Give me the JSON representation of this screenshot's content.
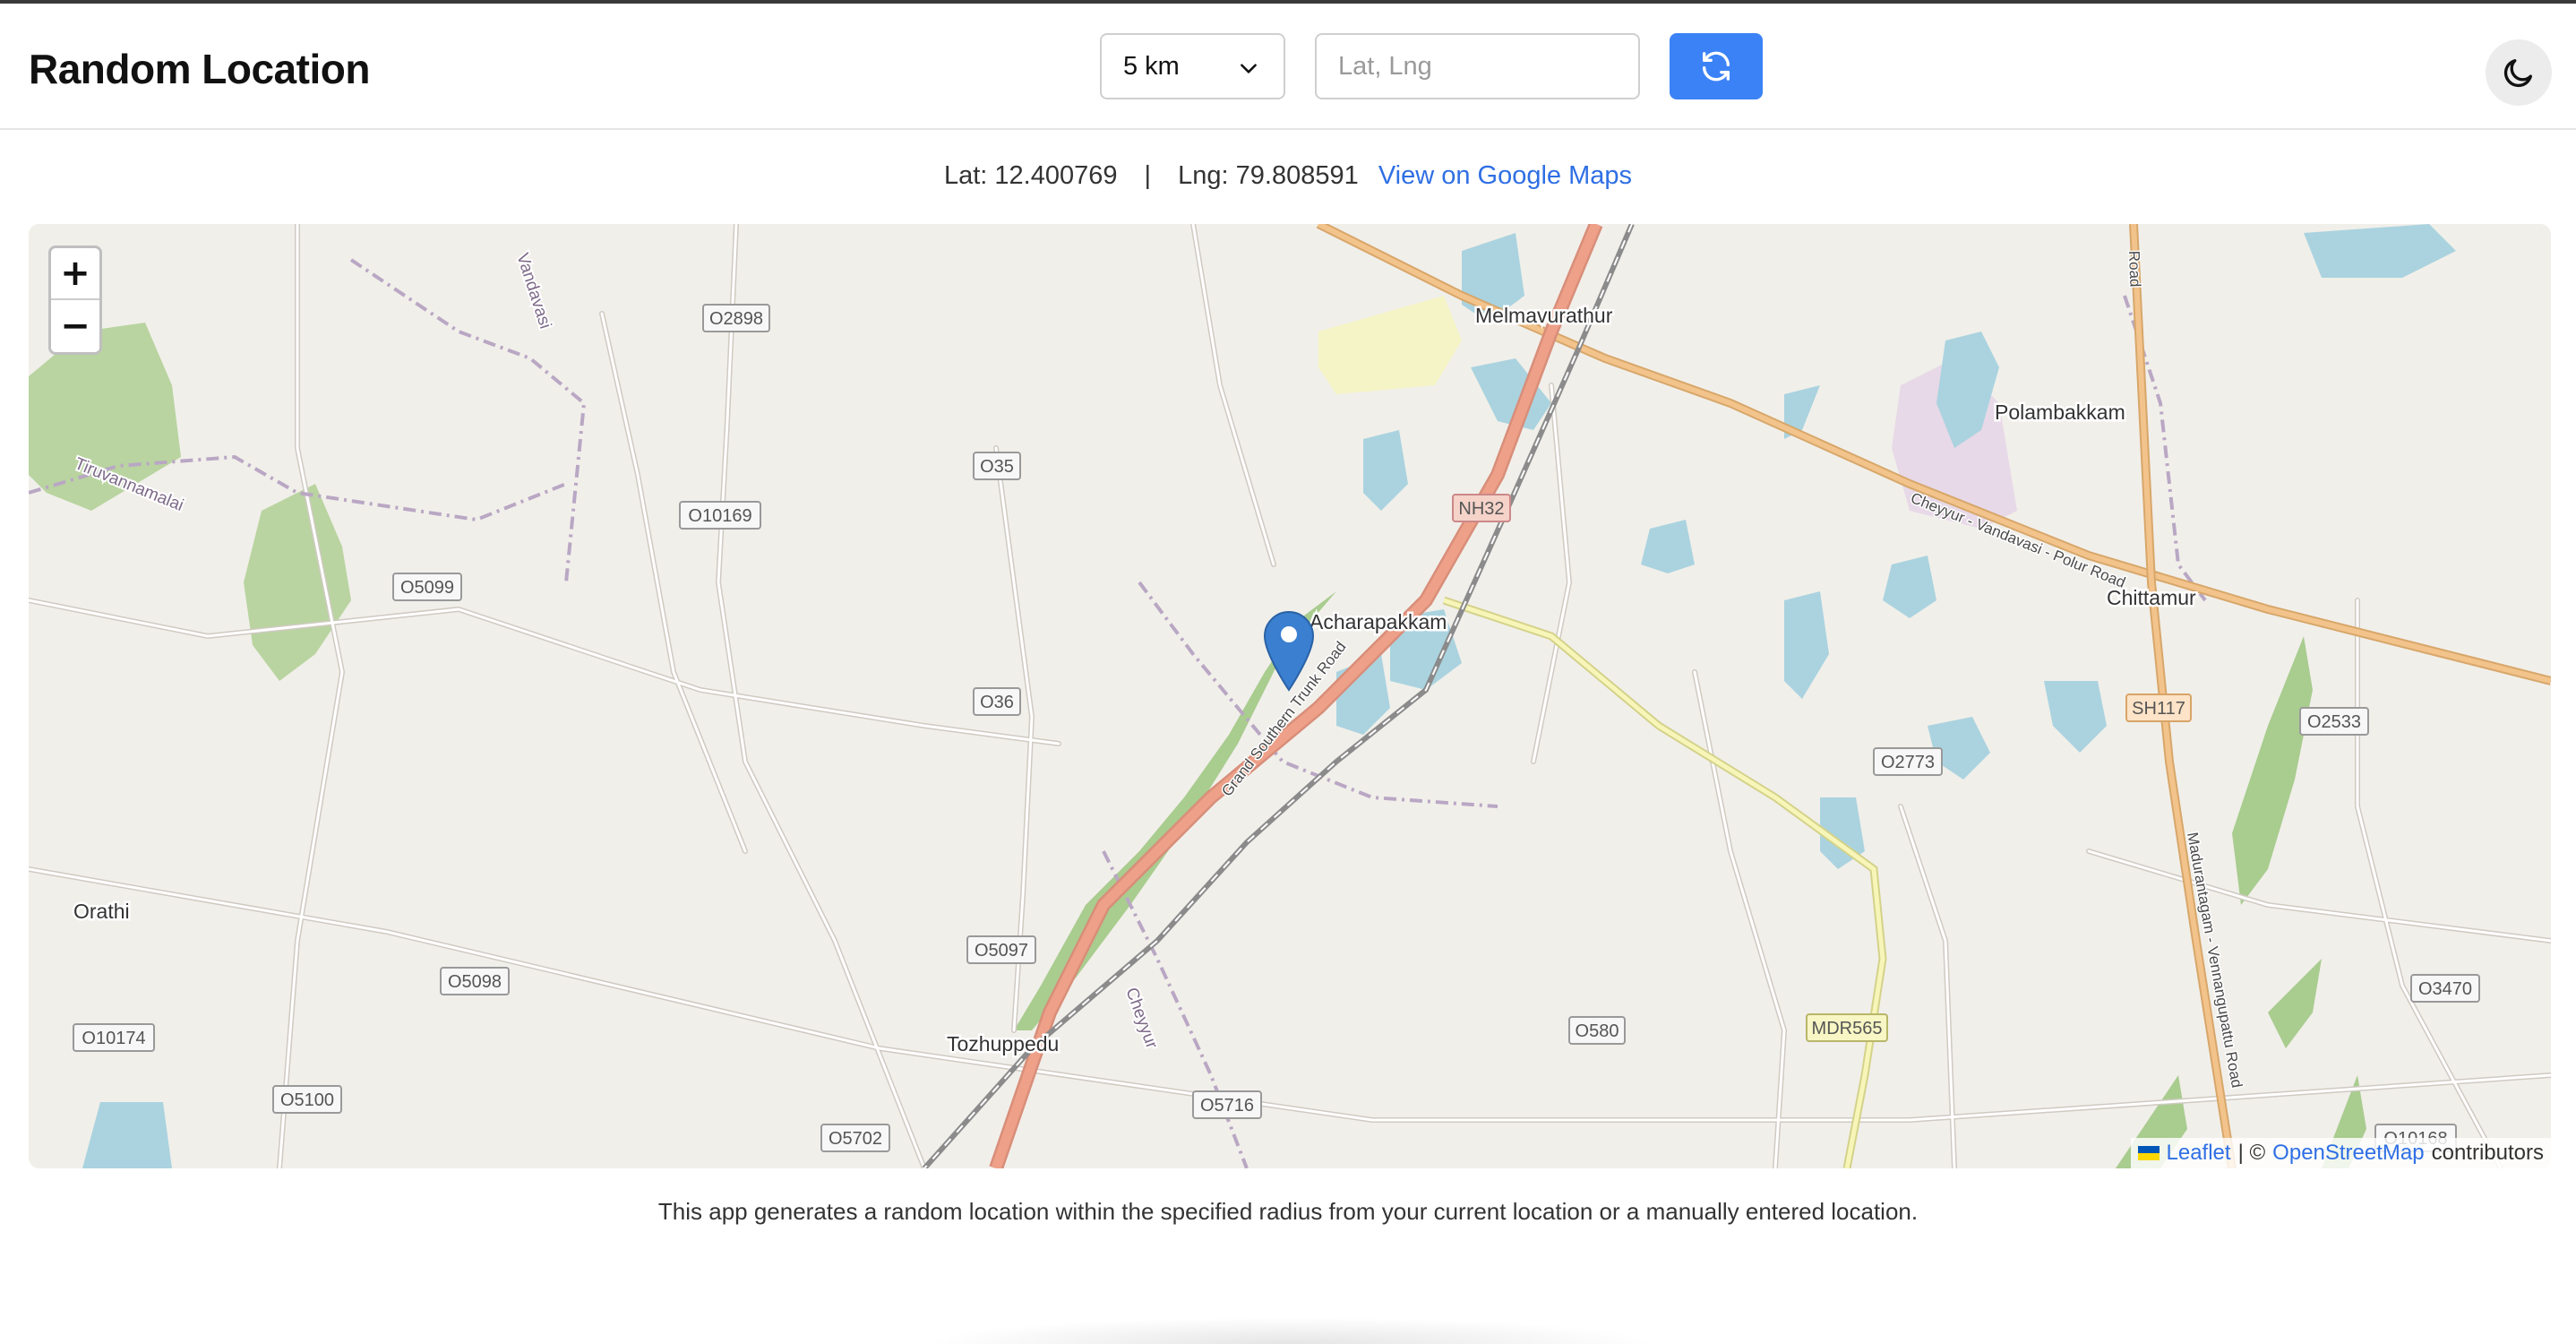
{
  "app": {
    "title": "Random Location"
  },
  "controls": {
    "radius": {
      "selected": "5 km"
    },
    "coordinates": {
      "placeholder": "Lat, Lng",
      "value": ""
    },
    "refresh_icon": "refresh-icon",
    "theme_icon": "moon-icon",
    "accent_color": "#3b82f6"
  },
  "result": {
    "lat": "Lat: 12.400769",
    "separator": "|",
    "lng": "Lng: 79.808591",
    "maps_link": "View on Google Maps"
  },
  "map": {
    "zoom_in": "+",
    "zoom_out": "−",
    "places": {
      "melmavurathur": "Melmavurathur",
      "polambakkam": "Polambakkam",
      "acharapakkam": "Acharapakkam",
      "chittamur": "Chittamur",
      "orathi": "Orathi",
      "tozhuppedu": "Tozhuppedu",
      "tiruvannamalai": "Tiruvannamalai",
      "vandavasi": "Vandavasi",
      "cheyyur": "Cheyyur"
    },
    "roads": {
      "cheyyur_road": "Cheyyur - Vandavasi - Polur Road",
      "gst_road": "Grand Southern Trunk Road",
      "madurantakam_road": "Madurantagam - Vennangupattu Road",
      "road_top": "Road"
    },
    "shields": {
      "o2898": "O2898",
      "o35": "O35",
      "o10169": "O10169",
      "o5099": "O5099",
      "o36": "O36",
      "nh32": "NH32",
      "sh117": "SH117",
      "o2533": "O2533",
      "o2773": "O2773",
      "o5097": "O5097",
      "o5098": "O5098",
      "o10174": "O10174",
      "o5100": "O5100",
      "o5702": "O5702",
      "o5716": "O5716",
      "o580": "O580",
      "mdr565": "MDR565",
      "o3470": "O3470",
      "o10168": "O10168"
    },
    "attribution": {
      "leaflet": "Leaflet",
      "separator": "| ©",
      "osm": "OpenStreetMap",
      "contributors": "contributors"
    },
    "marker_color": "#3a7fd0"
  },
  "footer": {
    "note": "This app generates a random location within the specified radius from your current location or a manually entered location."
  }
}
